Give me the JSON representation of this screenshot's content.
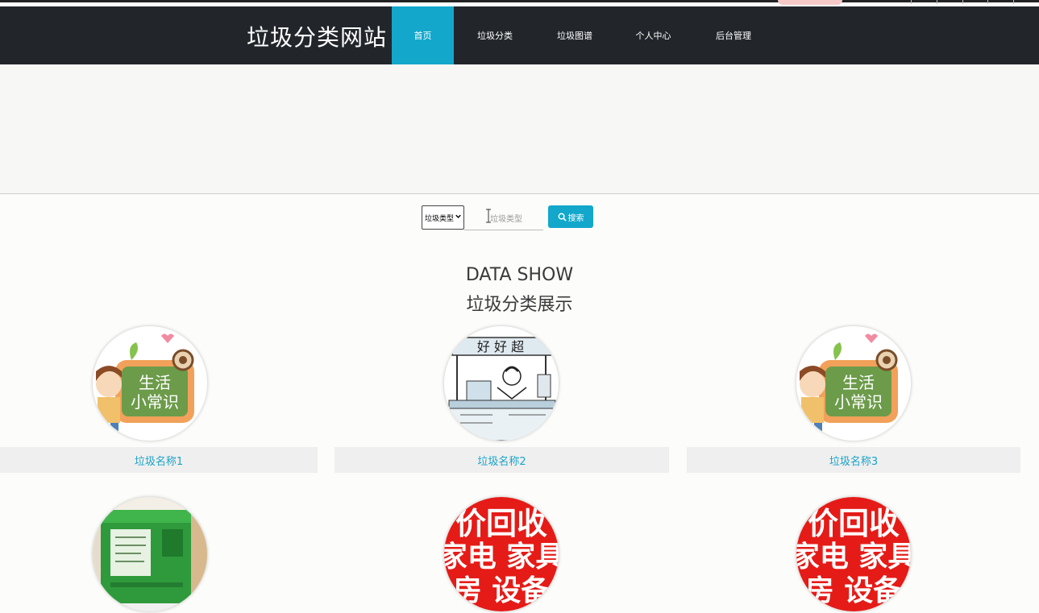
{
  "header": {
    "brand": "垃圾分类网站",
    "nav": [
      {
        "label": "首页",
        "active": true
      },
      {
        "label": "垃圾分类",
        "active": false
      },
      {
        "label": "垃圾图谱",
        "active": false
      },
      {
        "label": "个人中心",
        "active": false
      },
      {
        "label": "后台管理",
        "active": false
      }
    ]
  },
  "search": {
    "select_value": "垃圾类型",
    "input_placeholder": "垃圾类型",
    "button_label": "搜索"
  },
  "section": {
    "title_en": "DATA SHOW",
    "title_zh": "垃圾分类展示"
  },
  "items": [
    {
      "name": "垃圾名称1",
      "image": "life-tips-cartoon"
    },
    {
      "name": "垃圾名称2",
      "image": "sketch-vendor"
    },
    {
      "name": "垃圾名称3",
      "image": "life-tips-cartoon"
    },
    {
      "name": "",
      "image": "green-recycle-bin"
    },
    {
      "name": "",
      "image": "recycle-ad-red"
    },
    {
      "name": "",
      "image": "recycle-ad-red"
    }
  ],
  "image_text": {
    "life_tips_line1": "生活",
    "life_tips_line2": "小常识",
    "sketch_banner": "好 好 超",
    "ad_row1": "价回收",
    "ad_row2": "家电 家具",
    "ad_row3": "房 设备"
  },
  "colors": {
    "navbar": "#22262b",
    "accent": "#12a7cb",
    "caption_text": "#1aa3c9"
  }
}
